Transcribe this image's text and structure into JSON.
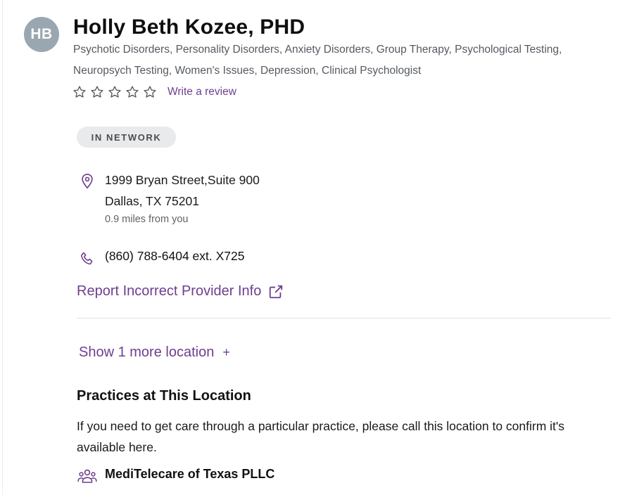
{
  "provider": {
    "initials": "HB",
    "name": "Holly Beth Kozee, PHD",
    "specialties": "Psychotic Disorders, Personality Disorders, Anxiety Disorders, Group Therapy, Psychological Testing, Neuropsych Testing, Women's Issues, Depression, Clinical Psychologist"
  },
  "rating": {
    "stars_filled": 0,
    "stars_total": 5,
    "write_review_label": "Write a review"
  },
  "badge": {
    "label": "IN NETWORK"
  },
  "location": {
    "address_line1": "1999 Bryan Street,Suite 900",
    "address_line2": "Dallas, TX 75201",
    "distance": "0.9 miles from you",
    "phone": "(860) 788-6404 ext. X725"
  },
  "report_link": {
    "label": "Report Incorrect Provider Info"
  },
  "show_more": {
    "label": "Show 1 more location",
    "symbol": "+"
  },
  "practices": {
    "title": "Practices at This Location",
    "description": "If you need to get care through a particular practice, please call this location to confirm it's available here.",
    "items": [
      {
        "name": "MediTelecare of Texas PLLC"
      }
    ]
  },
  "colors": {
    "accent": "#6e3e8f",
    "avatar_bg": "#9aa7b0",
    "badge_bg": "#e9eaec"
  },
  "icons": [
    "location-pin-icon",
    "phone-icon",
    "external-link-icon",
    "star-outline-icon",
    "group-icon"
  ]
}
